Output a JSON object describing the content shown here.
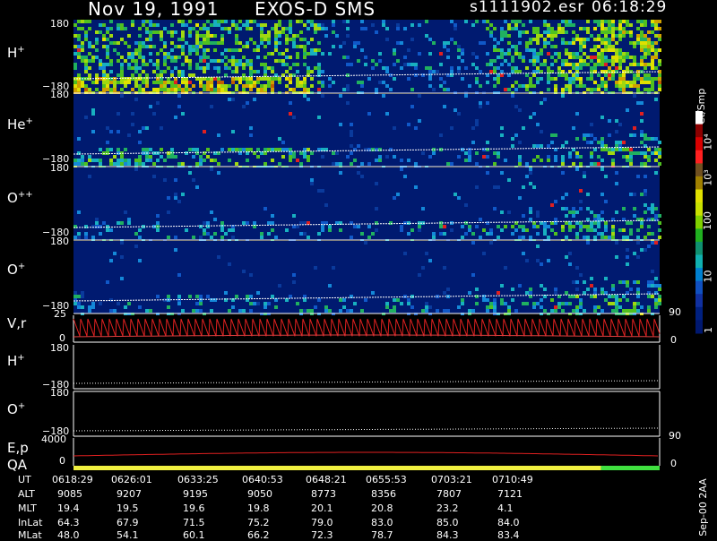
{
  "header": {
    "date": "Nov 19, 1991",
    "mission": "EXOS-D SMS",
    "file": "s1111902.esr",
    "time": "06:18:29"
  },
  "panels": [
    {
      "label": "H",
      "sup": "+",
      "top_tick": "180",
      "bottom_tick": "−180"
    },
    {
      "label": "He",
      "sup": "+",
      "top_tick": "180",
      "bottom_tick": "−180"
    },
    {
      "label": "O",
      "sup": "++",
      "top_tick": "180",
      "bottom_tick": "−180"
    },
    {
      "label": "O",
      "sup": "+",
      "top_tick": "180",
      "bottom_tick": "−180"
    }
  ],
  "vr_panel": {
    "label": "V,r",
    "top_tick": "25",
    "bottom_tick": "0",
    "right_top": "90",
    "right_bottom": "0"
  },
  "h_line_panel": {
    "label": "H",
    "sup": "+",
    "top_tick": "180",
    "bottom_tick": "−180"
  },
  "o_line_panel": {
    "label": "O",
    "sup": "+",
    "top_tick": "180",
    "bottom_tick": "−180"
  },
  "ep_panel": {
    "label1": "E,p",
    "label2": "QA",
    "top_tick": "4000",
    "bottom_tick": "0",
    "right_top": "90",
    "right_bottom": "0"
  },
  "colorbar": {
    "unit": "Ct/Smp",
    "labels": [
      "10⁴",
      "10³",
      "100",
      "10",
      "1"
    ],
    "colors": [
      "#ffffff",
      "#8b0000",
      "#d80000",
      "#ff2020",
      "#705020",
      "#a08000",
      "#e0e000",
      "#c8e000",
      "#80d000",
      "#20b020",
      "#109070",
      "#10b0b0",
      "#0080d0",
      "#1050c0",
      "#1030a0",
      "#002080",
      "#001870"
    ]
  },
  "footer": "Sep-00  2AA",
  "table": {
    "row_labels": [
      "UT",
      "ALT",
      "MLT",
      "InLat",
      "MLat"
    ],
    "columns": [
      [
        "0618:29",
        "9085",
        "19.4",
        "64.3",
        "48.0"
      ],
      [
        "0626:01",
        "9207",
        "19.5",
        "67.9",
        "54.1"
      ],
      [
        "0633:25",
        "9195",
        "19.6",
        "71.5",
        "60.1"
      ],
      [
        "0640:53",
        "9050",
        "19.8",
        "75.2",
        "66.2"
      ],
      [
        "0648:21",
        "8773",
        "20.1",
        "79.0",
        "72.3"
      ],
      [
        "0655:53",
        "8356",
        "20.8",
        "83.0",
        "78.7"
      ],
      [
        "0703:21",
        "7807",
        "23.2",
        "85.0",
        "84.3"
      ],
      [
        "0710:49",
        "7121",
        "4.1",
        "84.0",
        "83.4"
      ]
    ]
  },
  "chart_data": {
    "type": "heatmap",
    "x_axis": "UT",
    "x_ticks": [
      "0618:29",
      "0626:01",
      "0633:25",
      "0640:53",
      "0648:21",
      "0655:53",
      "0703:21",
      "0710:49"
    ],
    "spectrogram_panels": [
      "H+",
      "He+",
      "O++",
      "O+"
    ],
    "y_range_angle": [
      -180,
      180
    ],
    "color_scale": "log",
    "color_range": [
      1,
      10000
    ],
    "vr_range": [
      0,
      25
    ],
    "energy_range": [
      0,
      4000
    ],
    "qa_segments": [
      {
        "from_fraction": 0.0,
        "to_fraction": 0.9,
        "color": "#f0f040"
      },
      {
        "from_fraction": 0.9,
        "to_fraction": 1.0,
        "color": "#40e040"
      }
    ]
  }
}
